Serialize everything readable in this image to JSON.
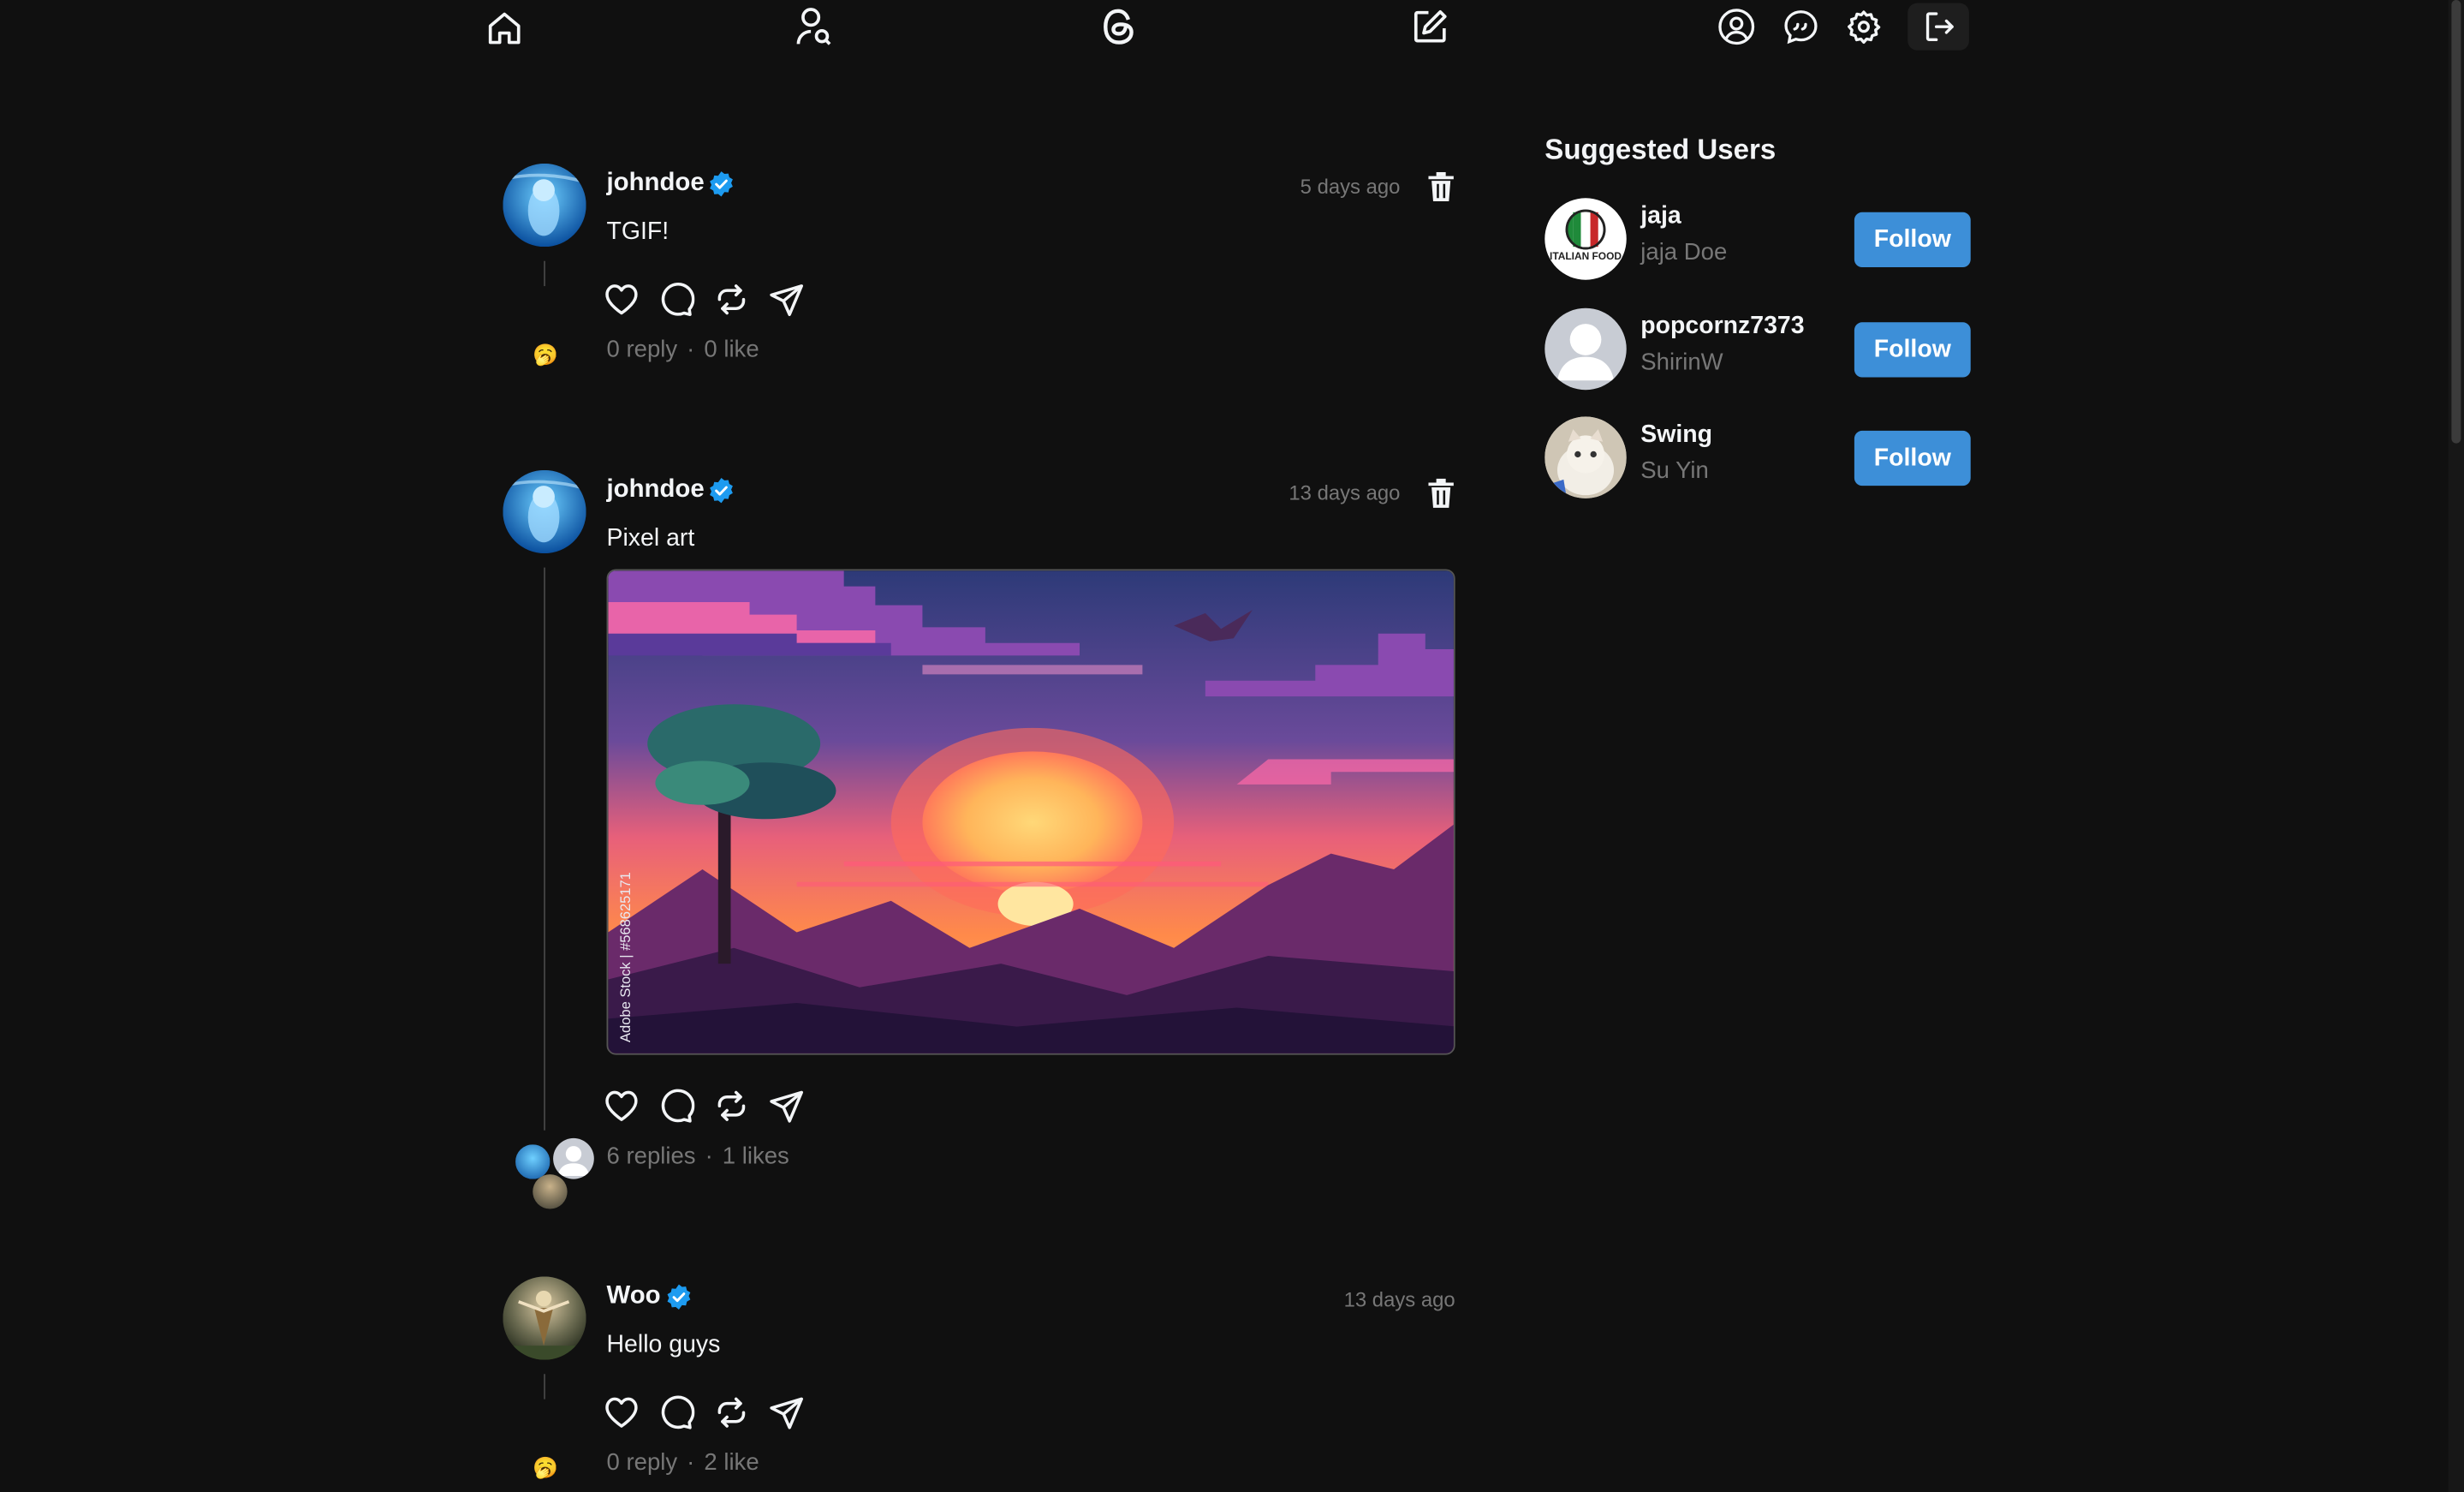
{
  "colors": {
    "background": "#101010",
    "text": "#f3f5f7",
    "muted": "#777777",
    "accent": "#3d8fd8",
    "verified": "#1d9bf0"
  },
  "nav": {
    "icons": [
      "home-icon",
      "search-user-icon",
      "threads-logo-icon",
      "compose-icon",
      "profile-icon",
      "chat-icon",
      "settings-icon",
      "logout-icon"
    ]
  },
  "posts": [
    {
      "username": "johndoe",
      "verified": true,
      "time": "5 days ago",
      "text": "TGIF!",
      "replies": "0 reply",
      "likes": "0 like",
      "deletable": true
    },
    {
      "username": "johndoe",
      "verified": true,
      "time": "13 days ago",
      "text": "Pixel art",
      "image_caption": "Adobe Stock | #568625171",
      "replies": "6 replies",
      "likes": "1 likes",
      "deletable": true
    },
    {
      "username": "Woo",
      "verified": true,
      "time": "13 days ago",
      "text": "Hello guys",
      "replies": "0 reply",
      "likes": "2 like",
      "deletable": false
    }
  ],
  "suggested": {
    "title": "Suggested Users",
    "users": [
      {
        "username": "jaja",
        "name": "jaja Doe",
        "button": "Follow",
        "avatar_label": "ITALIAN FOOD"
      },
      {
        "username": "popcornz7373",
        "name": "ShirinW",
        "button": "Follow"
      },
      {
        "username": "Swing",
        "name": "Su Yin",
        "button": "Follow"
      }
    ]
  },
  "separator": "·",
  "no_reply_emoji": "🥱"
}
